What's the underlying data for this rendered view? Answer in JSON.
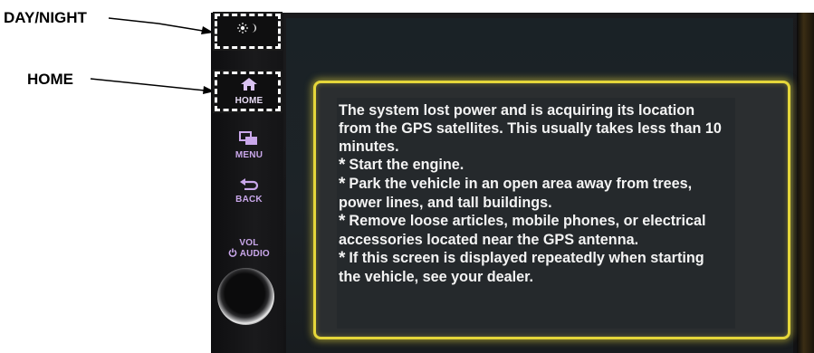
{
  "callouts": {
    "day_night": "DAY/NIGHT",
    "home": "HOME"
  },
  "side_buttons": {
    "home_label": "HOME",
    "menu_label": "MENU",
    "back_label": "BACK",
    "vol_label": "VOL",
    "audio_label": "AUDIO",
    "day_night_icon": "sun-moon-icon",
    "home_icon": "house-icon",
    "menu_icon": "menu-icon",
    "back_icon": "back-arrow-icon",
    "power_icon": "power-icon"
  },
  "dialog": {
    "intro": "The system lost power and is acquiring its location from the GPS satellites. This usually takes less than 10 minutes.",
    "bullets": [
      "Start the engine.",
      "Park the vehicle in an open area away from trees, power lines, and tall buildings.",
      "Remove loose articles, mobile phones, or electrical accessories located near the GPS antenna.",
      "If this screen is displayed repeatedly when starting the vehicle, see your dealer."
    ],
    "bullet_marker": "*",
    "border_color": "#e5d63a"
  },
  "colors": {
    "button_text": "#c9a7ea",
    "screen_bg": "#1d2327"
  }
}
